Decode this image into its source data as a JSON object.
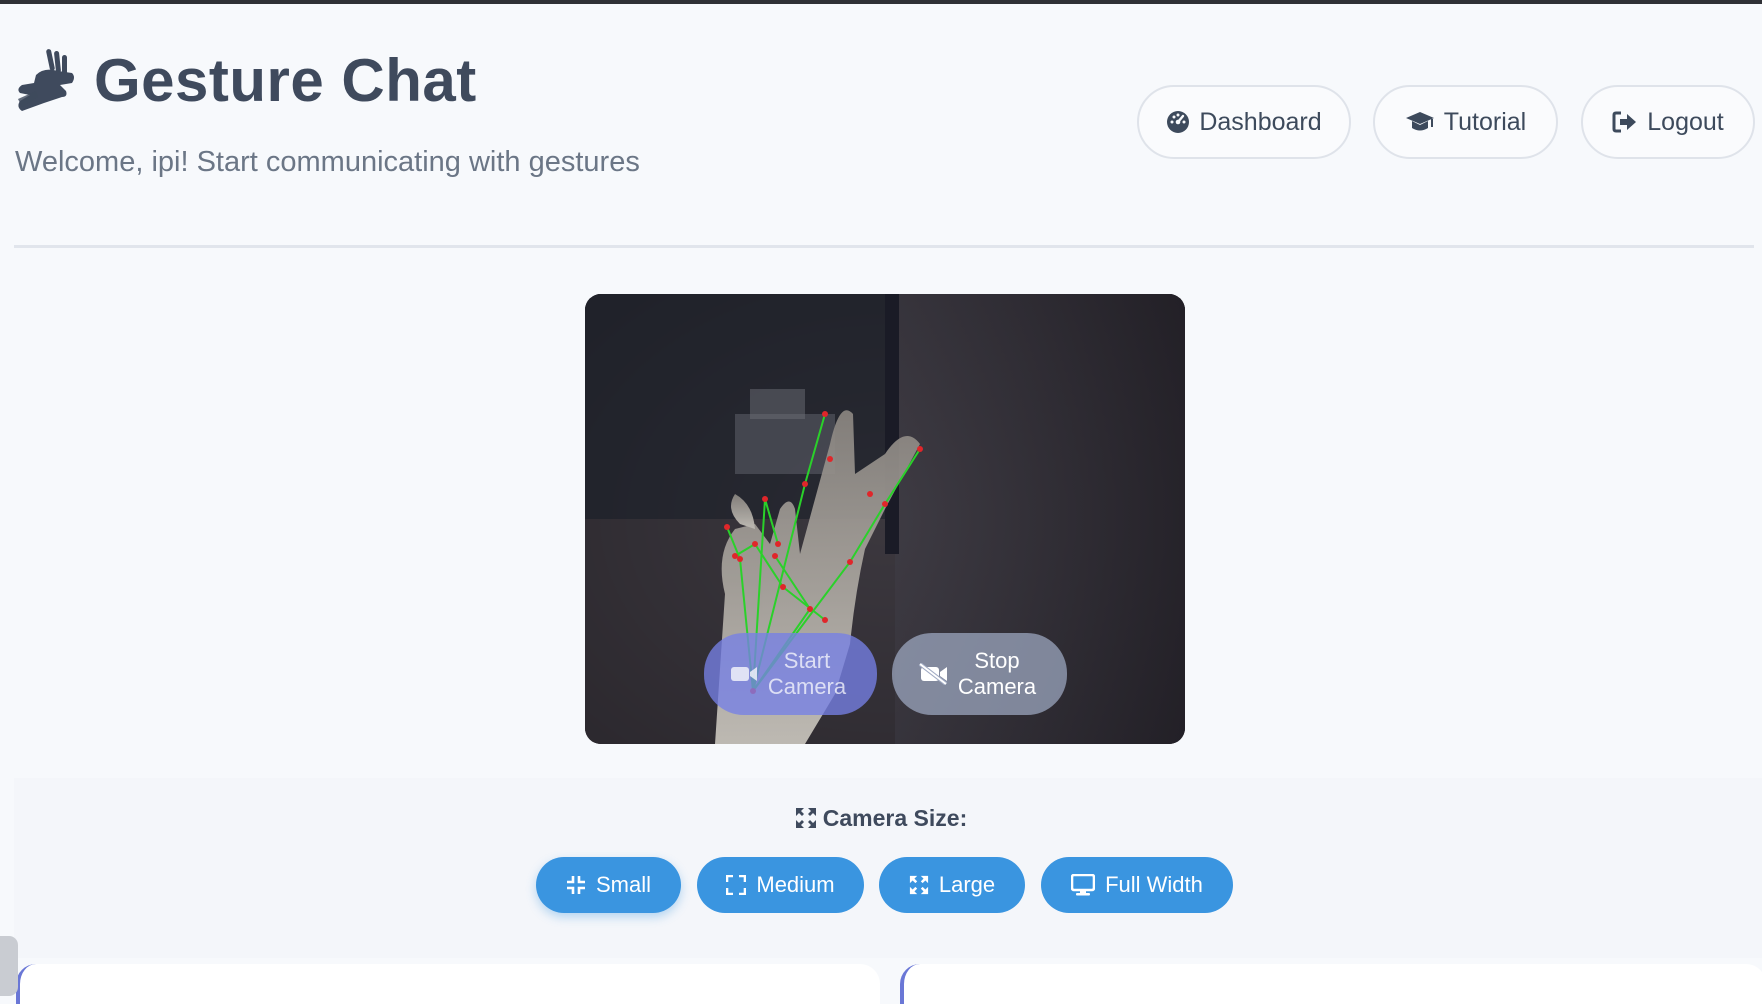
{
  "app": {
    "title": "Gesture Chat",
    "subtitle": "Welcome, ipi! Start communicating with gestures"
  },
  "nav": {
    "dashboard": "Dashboard",
    "tutorial": "Tutorial",
    "logout": "Logout"
  },
  "camera": {
    "start_line1": "Start",
    "start_line2": "Camera",
    "stop_line1": "Stop",
    "stop_line2": "Camera"
  },
  "size_controls": {
    "title": "Camera Size:",
    "small": "Small",
    "medium": "Medium",
    "large": "Large",
    "full_width": "Full Width"
  },
  "colors": {
    "accent": "#3a95e0",
    "start_button": "#7680e6",
    "stop_button": "#a0aac3",
    "landmark_line": "#2ad12a",
    "landmark_point": "#e0262a"
  },
  "icons": {
    "title": "sign-language-hand-icon",
    "dashboard": "tachometer-icon",
    "tutorial": "graduation-cap-icon",
    "logout": "sign-out-icon",
    "start": "video-icon",
    "stop": "video-slash-icon",
    "camera_size": "expand-arrows-icon",
    "small": "compress-icon",
    "medium": "expand-icon",
    "large": "expand-arrows-icon",
    "full_width": "desktop-icon"
  }
}
